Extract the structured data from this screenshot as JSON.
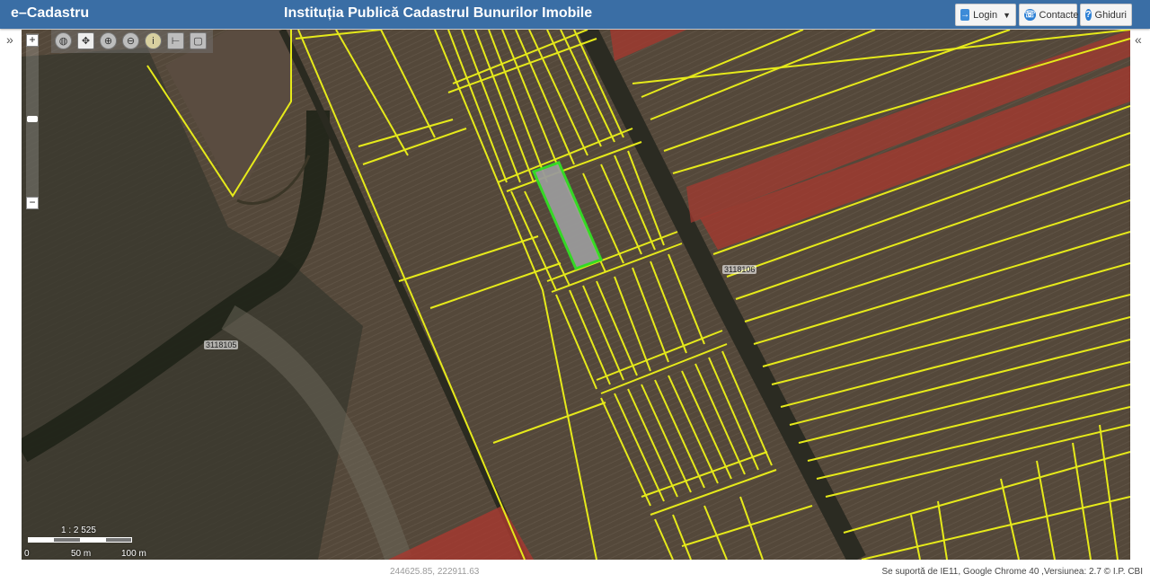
{
  "header": {
    "app_title": "e–Cadastru",
    "org_title": "Instituția Publică Cadastrul Bunurilor Imobile",
    "login_label": "Login",
    "contact_label": "Contacte",
    "guide_label": "Ghiduri",
    "brand_color": "#3a6ea5"
  },
  "panels": {
    "left_toggle": "»",
    "right_toggle": "«"
  },
  "map": {
    "zoom_in": "+",
    "zoom_out": "−",
    "tools": [
      "globe-icon",
      "pan-icon",
      "zoom-in-icon",
      "zoom-out-icon",
      "info-icon",
      "measure-distance-icon",
      "measure-area-icon"
    ],
    "parcel_labels": [
      "3118105",
      "3118106"
    ],
    "scale": "1 : 2 525",
    "scale_ticks": [
      "0",
      "50 m",
      "100 m"
    ],
    "colors": {
      "parcel_line": "#e6ea1a",
      "selected_parcel": "#33e024",
      "highlight_parcel": "#b03a32"
    }
  },
  "footer": {
    "coordinates": "244625.85, 222911.63",
    "support": "Se suportă de IE11, Google Chrome 40 ,Versiunea: 2.7 © I.P. CBI"
  }
}
